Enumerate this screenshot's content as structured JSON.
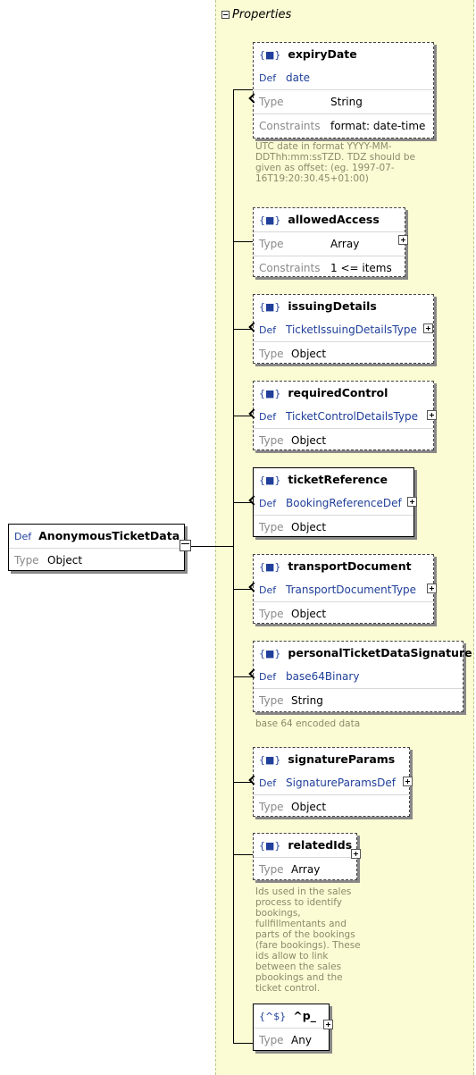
{
  "root": {
    "badge": "Def",
    "name": "AnonymousTicketData",
    "type_label": "Type",
    "type_value": "Object"
  },
  "properties_label": "Properties",
  "labels": {
    "def": "Def",
    "type": "Type",
    "constraints": "Constraints",
    "obj_badge": "{■}",
    "pattern_badge": "{^$}"
  },
  "items": [
    {
      "name": "expiryDate",
      "def": "date",
      "type": "String",
      "constraints": "format: date-time",
      "desc": "UTC date in format YYYY-MM-DDThh:mm:ssTZD. TDZ should be given as offset: (eg. 1997-07-16T19:20:30.45+01:00)"
    },
    {
      "name": "allowedAccess",
      "type": "Array",
      "constraints": "1 <= items"
    },
    {
      "name": "issuingDetails",
      "def": "TicketIssuingDetailsType",
      "type": "Object"
    },
    {
      "name": "requiredControl",
      "def": "TicketControlDetailsType",
      "type": "Object"
    },
    {
      "name": "ticketReference",
      "def": "BookingReferenceDef",
      "type": "Object"
    },
    {
      "name": "transportDocument",
      "def": "TransportDocumentType",
      "type": "Object"
    },
    {
      "name": "personalTicketDataSignature",
      "def": "base64Binary",
      "type": "String",
      "desc": "base 64 encoded data"
    },
    {
      "name": "signatureParams",
      "def": "SignatureParamsDef",
      "type": "Object"
    },
    {
      "name": "relatedIds",
      "type": "Array",
      "desc": "Ids used in the sales process to identify bookings, fullfillmentants and parts of the bookings (fare bookings). These ids allow to link between the sales pbookings and the ticket control."
    },
    {
      "name": "^p_",
      "type": "Any"
    }
  ]
}
